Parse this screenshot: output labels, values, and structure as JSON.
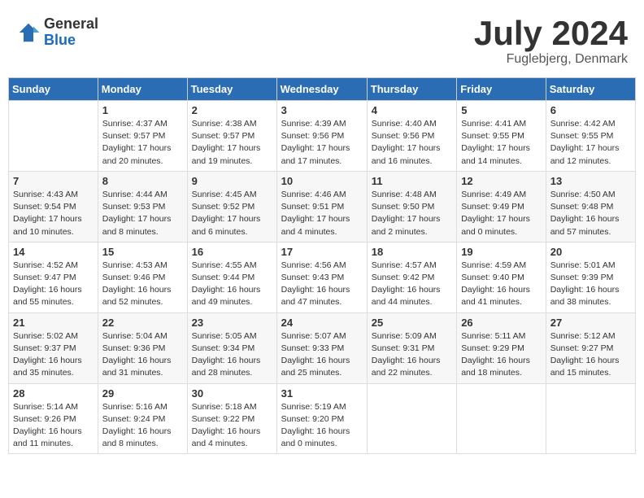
{
  "header": {
    "logo_general": "General",
    "logo_blue": "Blue",
    "month_title": "July 2024",
    "location": "Fuglebjerg, Denmark"
  },
  "weekdays": [
    "Sunday",
    "Monday",
    "Tuesday",
    "Wednesday",
    "Thursday",
    "Friday",
    "Saturday"
  ],
  "weeks": [
    [
      {
        "day": "",
        "info": ""
      },
      {
        "day": "1",
        "info": "Sunrise: 4:37 AM\nSunset: 9:57 PM\nDaylight: 17 hours\nand 20 minutes."
      },
      {
        "day": "2",
        "info": "Sunrise: 4:38 AM\nSunset: 9:57 PM\nDaylight: 17 hours\nand 19 minutes."
      },
      {
        "day": "3",
        "info": "Sunrise: 4:39 AM\nSunset: 9:56 PM\nDaylight: 17 hours\nand 17 minutes."
      },
      {
        "day": "4",
        "info": "Sunrise: 4:40 AM\nSunset: 9:56 PM\nDaylight: 17 hours\nand 16 minutes."
      },
      {
        "day": "5",
        "info": "Sunrise: 4:41 AM\nSunset: 9:55 PM\nDaylight: 17 hours\nand 14 minutes."
      },
      {
        "day": "6",
        "info": "Sunrise: 4:42 AM\nSunset: 9:55 PM\nDaylight: 17 hours\nand 12 minutes."
      }
    ],
    [
      {
        "day": "7",
        "info": "Sunrise: 4:43 AM\nSunset: 9:54 PM\nDaylight: 17 hours\nand 10 minutes."
      },
      {
        "day": "8",
        "info": "Sunrise: 4:44 AM\nSunset: 9:53 PM\nDaylight: 17 hours\nand 8 minutes."
      },
      {
        "day": "9",
        "info": "Sunrise: 4:45 AM\nSunset: 9:52 PM\nDaylight: 17 hours\nand 6 minutes."
      },
      {
        "day": "10",
        "info": "Sunrise: 4:46 AM\nSunset: 9:51 PM\nDaylight: 17 hours\nand 4 minutes."
      },
      {
        "day": "11",
        "info": "Sunrise: 4:48 AM\nSunset: 9:50 PM\nDaylight: 17 hours\nand 2 minutes."
      },
      {
        "day": "12",
        "info": "Sunrise: 4:49 AM\nSunset: 9:49 PM\nDaylight: 17 hours\nand 0 minutes."
      },
      {
        "day": "13",
        "info": "Sunrise: 4:50 AM\nSunset: 9:48 PM\nDaylight: 16 hours\nand 57 minutes."
      }
    ],
    [
      {
        "day": "14",
        "info": "Sunrise: 4:52 AM\nSunset: 9:47 PM\nDaylight: 16 hours\nand 55 minutes."
      },
      {
        "day": "15",
        "info": "Sunrise: 4:53 AM\nSunset: 9:46 PM\nDaylight: 16 hours\nand 52 minutes."
      },
      {
        "day": "16",
        "info": "Sunrise: 4:55 AM\nSunset: 9:44 PM\nDaylight: 16 hours\nand 49 minutes."
      },
      {
        "day": "17",
        "info": "Sunrise: 4:56 AM\nSunset: 9:43 PM\nDaylight: 16 hours\nand 47 minutes."
      },
      {
        "day": "18",
        "info": "Sunrise: 4:57 AM\nSunset: 9:42 PM\nDaylight: 16 hours\nand 44 minutes."
      },
      {
        "day": "19",
        "info": "Sunrise: 4:59 AM\nSunset: 9:40 PM\nDaylight: 16 hours\nand 41 minutes."
      },
      {
        "day": "20",
        "info": "Sunrise: 5:01 AM\nSunset: 9:39 PM\nDaylight: 16 hours\nand 38 minutes."
      }
    ],
    [
      {
        "day": "21",
        "info": "Sunrise: 5:02 AM\nSunset: 9:37 PM\nDaylight: 16 hours\nand 35 minutes."
      },
      {
        "day": "22",
        "info": "Sunrise: 5:04 AM\nSunset: 9:36 PM\nDaylight: 16 hours\nand 31 minutes."
      },
      {
        "day": "23",
        "info": "Sunrise: 5:05 AM\nSunset: 9:34 PM\nDaylight: 16 hours\nand 28 minutes."
      },
      {
        "day": "24",
        "info": "Sunrise: 5:07 AM\nSunset: 9:33 PM\nDaylight: 16 hours\nand 25 minutes."
      },
      {
        "day": "25",
        "info": "Sunrise: 5:09 AM\nSunset: 9:31 PM\nDaylight: 16 hours\nand 22 minutes."
      },
      {
        "day": "26",
        "info": "Sunrise: 5:11 AM\nSunset: 9:29 PM\nDaylight: 16 hours\nand 18 minutes."
      },
      {
        "day": "27",
        "info": "Sunrise: 5:12 AM\nSunset: 9:27 PM\nDaylight: 16 hours\nand 15 minutes."
      }
    ],
    [
      {
        "day": "28",
        "info": "Sunrise: 5:14 AM\nSunset: 9:26 PM\nDaylight: 16 hours\nand 11 minutes."
      },
      {
        "day": "29",
        "info": "Sunrise: 5:16 AM\nSunset: 9:24 PM\nDaylight: 16 hours\nand 8 minutes."
      },
      {
        "day": "30",
        "info": "Sunrise: 5:18 AM\nSunset: 9:22 PM\nDaylight: 16 hours\nand 4 minutes."
      },
      {
        "day": "31",
        "info": "Sunrise: 5:19 AM\nSunset: 9:20 PM\nDaylight: 16 hours\nand 0 minutes."
      },
      {
        "day": "",
        "info": ""
      },
      {
        "day": "",
        "info": ""
      },
      {
        "day": "",
        "info": ""
      }
    ]
  ]
}
